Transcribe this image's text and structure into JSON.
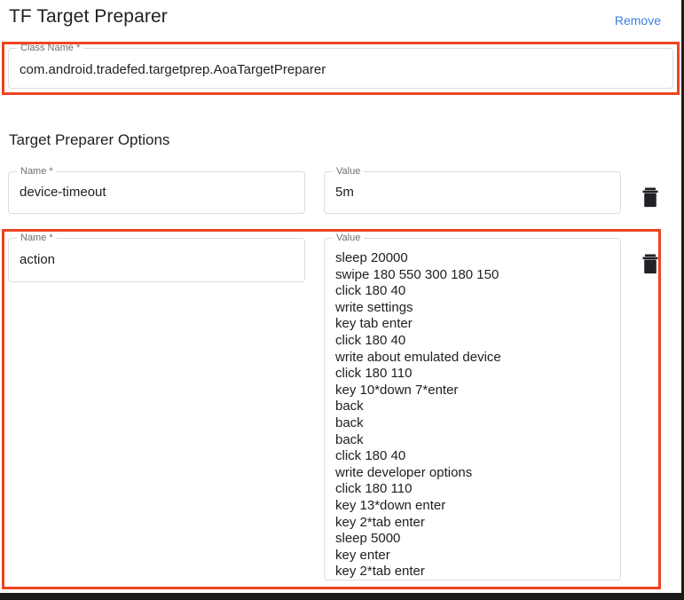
{
  "header": {
    "title": "TF Target Preparer",
    "remove_label": "Remove",
    "remove_color": "#3f7fe0"
  },
  "class_field": {
    "legend": "Class Name *",
    "value": "com.android.tradefed.targetprep.AoaTargetPreparer",
    "highlighted": true,
    "highlight_color": "#ef4422"
  },
  "options": {
    "heading": "Target Preparer Options",
    "name_legend": "Name *",
    "value_legend": "Value",
    "delete_icon": "trash-icon",
    "rows": [
      {
        "name": "device-timeout",
        "value": "5m",
        "highlighted": false
      },
      {
        "name": "action",
        "value": "sleep 20000\nswipe 180 550 300 180 150\nclick 180 40\nwrite settings\nkey tab enter\nclick 180 40\nwrite about emulated device\nclick 180 110\nkey 10*down 7*enter\nback\nback\nback\nclick 180 40\nwrite developer options\nclick 180 110\nkey 13*down enter\nkey 2*tab enter\nsleep 5000\nkey enter\nkey 2*tab enter",
        "highlighted": true
      }
    ]
  }
}
